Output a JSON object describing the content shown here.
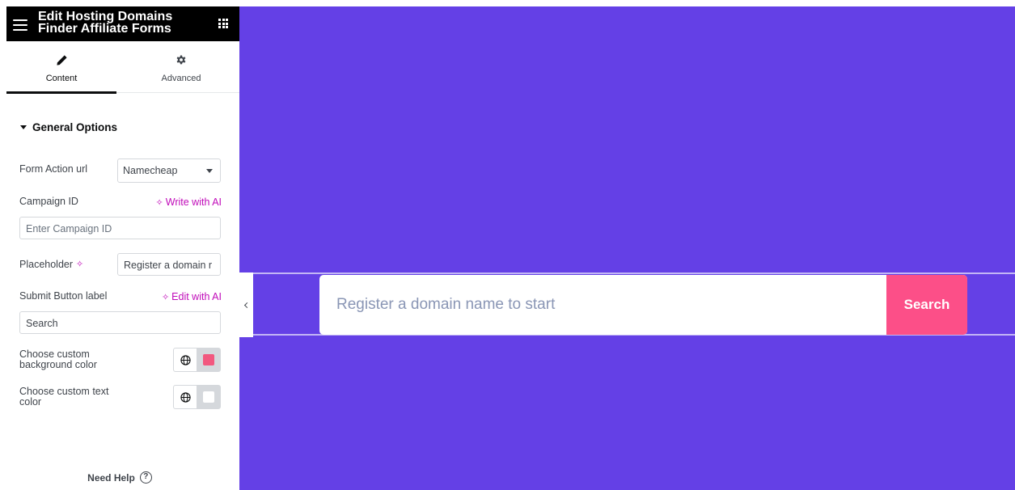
{
  "header": {
    "title": "Edit Hosting Domains Finder Affiliate Forms",
    "menu_icon": "hamburger-icon",
    "apps_icon": "grid-icon"
  },
  "tabs": [
    {
      "label": "Content",
      "icon": "pencil-icon",
      "active": true
    },
    {
      "label": "Advanced",
      "icon": "gear-icon",
      "active": false
    }
  ],
  "section": {
    "title": "General Options",
    "expanded": true
  },
  "controls": {
    "form_action_url": {
      "label": "Form Action url",
      "value": "Namecheap"
    },
    "campaign_id": {
      "label": "Campaign ID",
      "ai_link": "Write with AI",
      "placeholder": "Enter Campaign ID"
    },
    "placeholder": {
      "label": "Placeholder",
      "value": "Register a domain r"
    },
    "submit_label": {
      "label": "Submit Button label",
      "ai_link": "Edit with AI",
      "value": "Search"
    },
    "bg_color": {
      "label": "Choose custom background color",
      "swatch": "#f2587f"
    },
    "text_color": {
      "label": "Choose custom text color",
      "swatch": "#ffffff"
    }
  },
  "footer": {
    "help_label": "Need Help",
    "help_glyph": "?"
  },
  "preview": {
    "background": "#6440e6",
    "search_placeholder": "Register a domain name to start",
    "search_button": "Search",
    "button_color": "#fc4f88"
  }
}
